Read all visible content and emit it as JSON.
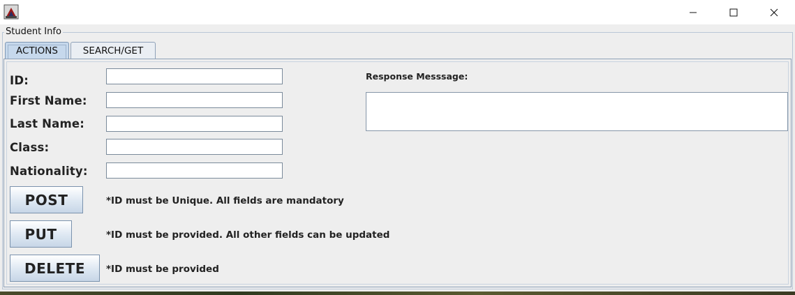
{
  "window": {
    "app_icon": "java-app-icon",
    "minimize_glyph": "—",
    "maximize_glyph": "☐",
    "close_glyph": "✕"
  },
  "group": {
    "title": "Student Info"
  },
  "tabs": [
    {
      "label": "ACTIONS",
      "selected": true
    },
    {
      "label": "SEARCH/GET",
      "selected": false
    }
  ],
  "form": {
    "fields": [
      {
        "label": "ID:",
        "value": ""
      },
      {
        "label": "First Name:",
        "value": ""
      },
      {
        "label": "Last Name:",
        "value": ""
      },
      {
        "label": "Class:",
        "value": ""
      },
      {
        "label": "Nationality:",
        "value": ""
      }
    ],
    "response_label": "Response Messsage:",
    "response_value": ""
  },
  "actions": [
    {
      "label": "POST",
      "note": "*ID must be Unique. All fields are mandatory"
    },
    {
      "label": "PUT",
      "note": "*ID must be provided. All other fields can be updated"
    },
    {
      "label": "DELETE",
      "note": "*ID must be provided"
    }
  ],
  "colors": {
    "selected_tab": "#c6d8ec",
    "button_gradient_top": "#ffffff",
    "button_gradient_bottom": "#c7d6e7",
    "window_bg": "#eeeeee"
  }
}
